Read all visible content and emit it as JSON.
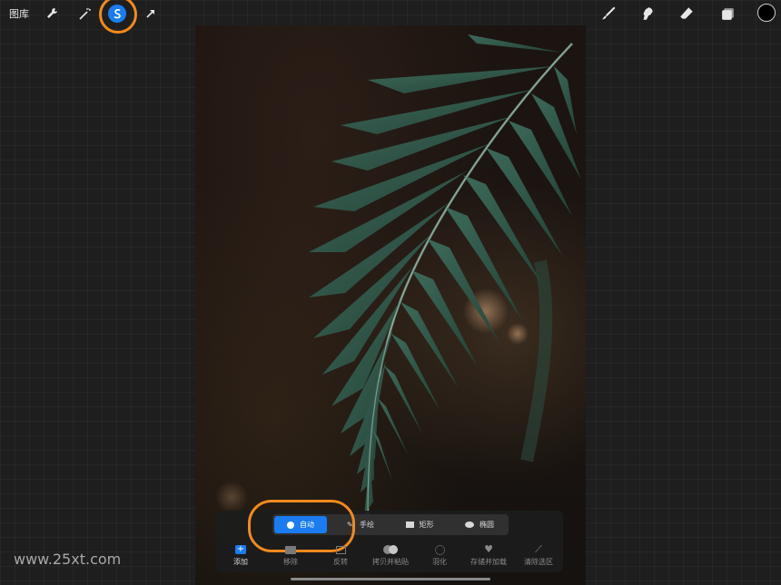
{
  "topbar": {
    "gallery_label": "图库",
    "tools_left": [
      {
        "icon": "wrench-icon"
      },
      {
        "icon": "magic-wand-icon"
      },
      {
        "icon": "selection-s-icon",
        "active": true
      },
      {
        "icon": "transform-arrow-icon"
      }
    ],
    "tools_right": [
      {
        "icon": "brush-icon"
      },
      {
        "icon": "smudge-icon"
      },
      {
        "icon": "eraser-icon"
      },
      {
        "icon": "layers-icon"
      },
      {
        "icon": "color-swatch",
        "value": "#000000"
      }
    ]
  },
  "selection_modes": [
    {
      "label": "自动",
      "icon": "dot-icon",
      "active": true
    },
    {
      "label": "手绘",
      "icon": "freehand-icon"
    },
    {
      "label": "矩形",
      "icon": "rectangle-icon"
    },
    {
      "label": "椭圆",
      "icon": "ellipse-icon"
    }
  ],
  "actions": [
    {
      "label": "添加",
      "icon": "add-icon"
    },
    {
      "label": "移除",
      "icon": "remove-icon"
    },
    {
      "label": "反转",
      "icon": "invert-icon"
    },
    {
      "label": "拷贝并粘贴",
      "icon": "copy-paste-icon"
    },
    {
      "label": "羽化",
      "icon": "feather-icon"
    },
    {
      "label": "存储并加载",
      "icon": "heart-icon"
    },
    {
      "label": "清除选区",
      "icon": "clear-selection-icon"
    }
  ],
  "watermark": "www.25xt.com",
  "colors": {
    "accent": "#1a7cf0",
    "highlight_ring": "#f28a1c",
    "background": "#1e1e1e"
  }
}
